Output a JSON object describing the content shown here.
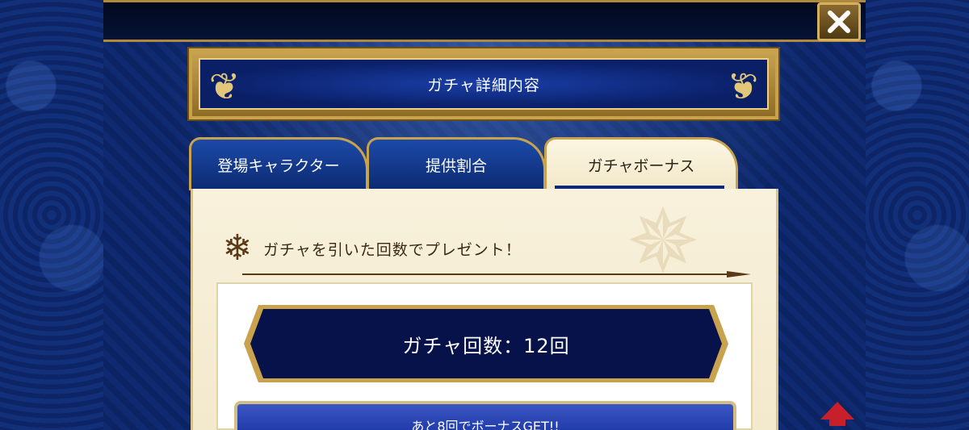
{
  "header": {
    "close_label": "✕"
  },
  "title_banner": {
    "title": "ガチャ詳細内容"
  },
  "tabs": [
    {
      "label": "登場キャラクター",
      "selected": false
    },
    {
      "label": "提供割合",
      "selected": false
    },
    {
      "label": "ガチャボーナス",
      "selected": true
    }
  ],
  "bonus_section": {
    "heading": "ガチャを引いた回数でプレゼント！",
    "gacha_count_text": "ガチャ回数：12回",
    "bonus_progress_text": "あと8回でボーナスGET!!"
  },
  "colors": {
    "accent_gold": "#c9a24e",
    "deep_blue": "#0a1f66",
    "parchment": "#f8f1dc",
    "scroll_arrow": "#c8202a"
  },
  "icons": {
    "close": "close-icon",
    "heading": "snowflake-icon",
    "scroll": "up-arrow-icon"
  }
}
